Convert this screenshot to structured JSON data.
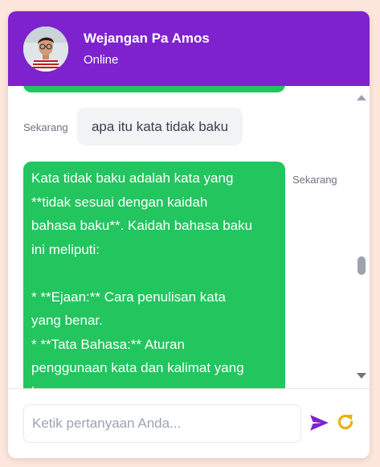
{
  "header": {
    "name": "Wejangan Pa Amos",
    "status": "Online",
    "brand_color": "#7e22ce"
  },
  "messages": [
    {
      "sender": "user",
      "timestamp": "Sekarang",
      "text": "apa itu kata tidak baku"
    },
    {
      "sender": "bot",
      "timestamp": "Sekarang",
      "bubble_color": "#22c55e",
      "lines": [
        "Kata tidak baku adalah kata yang",
        "**tidak sesuai dengan kaidah",
        "bahasa baku**. Kaidah bahasa baku",
        "ini meliputi:",
        "",
        "* **Ejaan:** Cara penulisan kata",
        "yang benar.",
        "* **Tata Bahasa:** Aturan",
        "penggunaan kata dan kalimat yang",
        "benar."
      ]
    }
  ],
  "composer": {
    "placeholder": "Ketik pertanyaan Anda...",
    "value": "",
    "send_icon": "send-icon",
    "reset_icon": "refresh-icon",
    "send_color": "#7e22ce",
    "reset_color": "#eab308"
  }
}
